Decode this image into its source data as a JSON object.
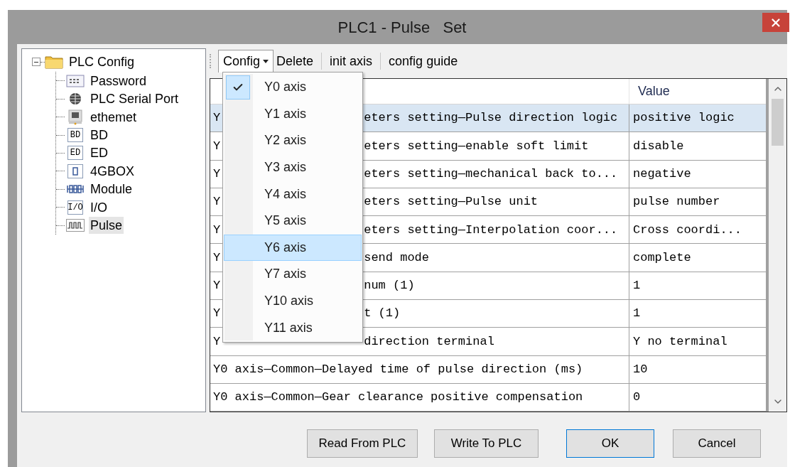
{
  "window": {
    "title": "PLC1 - Pulse   Set"
  },
  "tree": {
    "label": "PLC Config",
    "expanded": true,
    "selected": false,
    "children": [
      {
        "kind": "password",
        "label": "Password",
        "selected": false
      },
      {
        "kind": "serial",
        "label": "PLC Serial Port",
        "selected": false
      },
      {
        "kind": "ethernet",
        "label": "ethemet",
        "selected": false
      },
      {
        "kind": "text",
        "badge": "BD",
        "label": "BD",
        "selected": false
      },
      {
        "kind": "text",
        "badge": "ED",
        "label": "ED",
        "selected": false
      },
      {
        "kind": "box",
        "label": "4GBOX",
        "selected": false
      },
      {
        "kind": "module",
        "label": "Module",
        "selected": false
      },
      {
        "kind": "text",
        "badge": "I/O",
        "label": "I/O",
        "selected": false
      },
      {
        "kind": "pulse",
        "label": "Pulse",
        "selected": true
      }
    ]
  },
  "toolbar": [
    {
      "kind": "dropdown",
      "label": "Config",
      "open": true
    },
    {
      "kind": "button",
      "label": "Delete"
    },
    {
      "kind": "button",
      "label": "init axis"
    },
    {
      "kind": "button",
      "label": "config guide"
    }
  ],
  "menu": [
    {
      "label": "Y0 axis",
      "checked": true,
      "selected": false
    },
    {
      "label": "Y1 axis",
      "checked": false,
      "selected": false
    },
    {
      "label": "Y2 axis",
      "checked": false,
      "selected": false
    },
    {
      "label": "Y3 axis",
      "checked": false,
      "selected": false
    },
    {
      "label": "Y4 axis",
      "checked": false,
      "selected": false
    },
    {
      "label": "Y5 axis",
      "checked": false,
      "selected": false
    },
    {
      "label": "Y6 axis",
      "checked": false,
      "selected": true
    },
    {
      "label": "Y7 axis",
      "checked": false,
      "selected": false
    },
    {
      "label": "Y10 axis",
      "checked": false,
      "selected": false
    },
    {
      "label": "Y11 axis",
      "checked": false,
      "selected": false
    }
  ],
  "table": {
    "columns": [
      "Value"
    ],
    "rows": [
      {
        "name_start": "Y",
        "name_end": "eters setting—Pulse direction logic",
        "value": "positive logic",
        "selected": true
      },
      {
        "name_start": "Y",
        "name_end": "eters setting—enable soft limit",
        "value": "disable",
        "selected": false
      },
      {
        "name_start": "Y",
        "name_end": "eters setting—mechanical back to...",
        "value": "negative",
        "selected": false
      },
      {
        "name_start": "Y",
        "name_end": "eters setting—Pulse unit",
        "value": "pulse number",
        "selected": false
      },
      {
        "name_start": "Y",
        "name_end": "eters setting—Interpolation coor...",
        "value": "Cross coordi...",
        "selected": false
      },
      {
        "name_start": "Y",
        "name_end": "send mode",
        "value": "complete",
        "selected": false
      },
      {
        "name_start": "Y",
        "name_end": "num (1)",
        "value": "1",
        "selected": false
      },
      {
        "name_start": "Y",
        "name_end": "t (1)",
        "value": "1",
        "selected": false
      },
      {
        "name_start": "Y",
        "name_end": "direction terminal",
        "value": "Y no terminal",
        "selected": false
      },
      {
        "name": "Y0 axis—Common—Delayed time of pulse direction (ms)",
        "value": "10",
        "selected": false
      },
      {
        "name": "Y0 axis—Common—Gear clearance positive compensation",
        "value": "0",
        "selected": false
      }
    ]
  },
  "buttons": [
    {
      "label": "Read From PLC",
      "default": false
    },
    {
      "label": "Write To PLC",
      "default": false
    },
    {
      "label": "OK",
      "default": true
    },
    {
      "label": "Cancel",
      "default": false
    }
  ]
}
